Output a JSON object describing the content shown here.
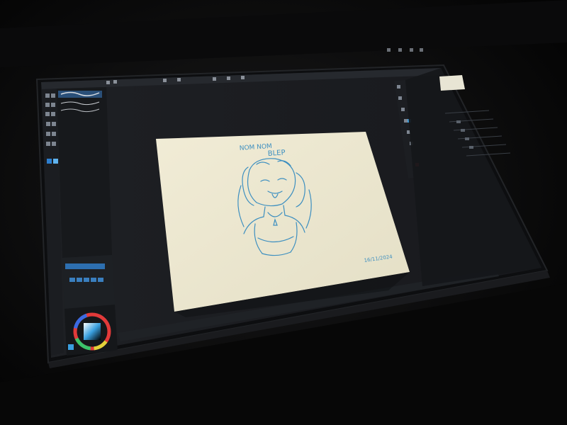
{
  "photo": {
    "subject": "pen display tablet running a drawing application"
  },
  "colors": {
    "room": "#050505",
    "tablet_body": "#111214",
    "screen": "#1b1d21",
    "panel": "#15171a",
    "paper": "#ece8d3",
    "sketch": "#3d8fc0",
    "accent": "#2d7fd0"
  },
  "sketch": {
    "speech_line_1": "NOM NOM",
    "speech_line_2": "BLEP",
    "date": "16/11/2024"
  },
  "icons": {
    "color_wheel": "color-wheel-icon",
    "brush_tool": "brush-icon",
    "layer": "layer-icon"
  }
}
